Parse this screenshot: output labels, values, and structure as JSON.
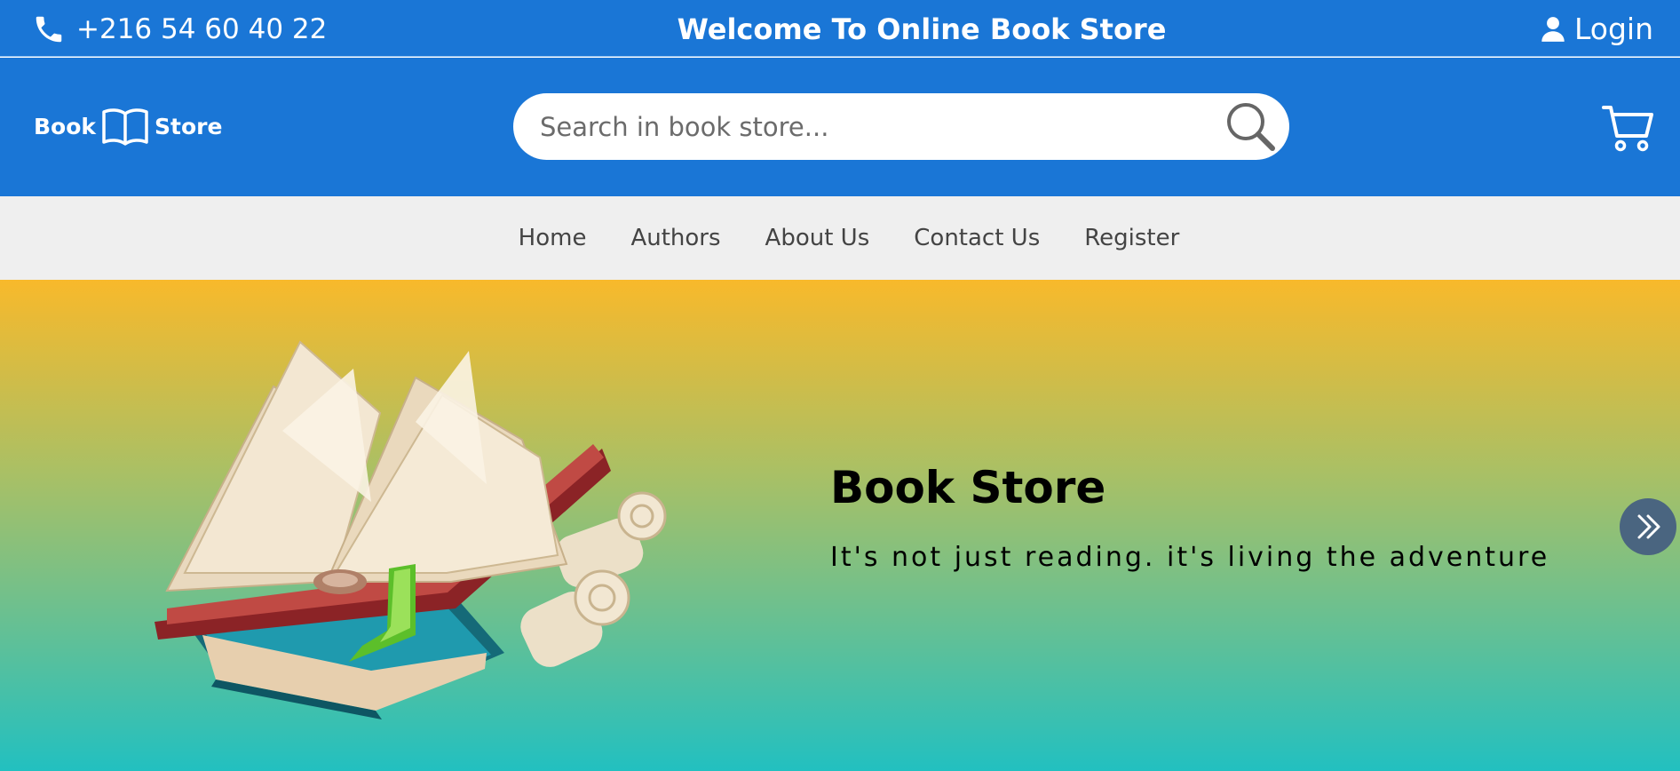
{
  "topbar": {
    "phone": "+216 54 60 40 22",
    "welcome": "Welcome To Online Book Store",
    "login_label": "Login"
  },
  "header": {
    "logo_left": "Book",
    "logo_right": "Store",
    "search_placeholder": "Search in book store...",
    "search_value": ""
  },
  "nav": {
    "items": [
      "Home",
      "Authors",
      "About Us",
      "Contact Us",
      "Register"
    ]
  },
  "hero": {
    "title": "Book Store",
    "subtitle": "It's not just reading. it's living the adventure"
  },
  "icons": {
    "phone": "phone-icon",
    "user": "user-icon",
    "logo": "open-book-icon",
    "search": "magnifier-icon",
    "cart": "cart-icon",
    "next": "double-chevron-right-icon"
  },
  "colors": {
    "primary": "#1a76d6",
    "nav_bg": "#efefef",
    "hero_top": "#f8b92b",
    "hero_bottom": "#22c0c0",
    "next_btn": "#4a6580"
  }
}
